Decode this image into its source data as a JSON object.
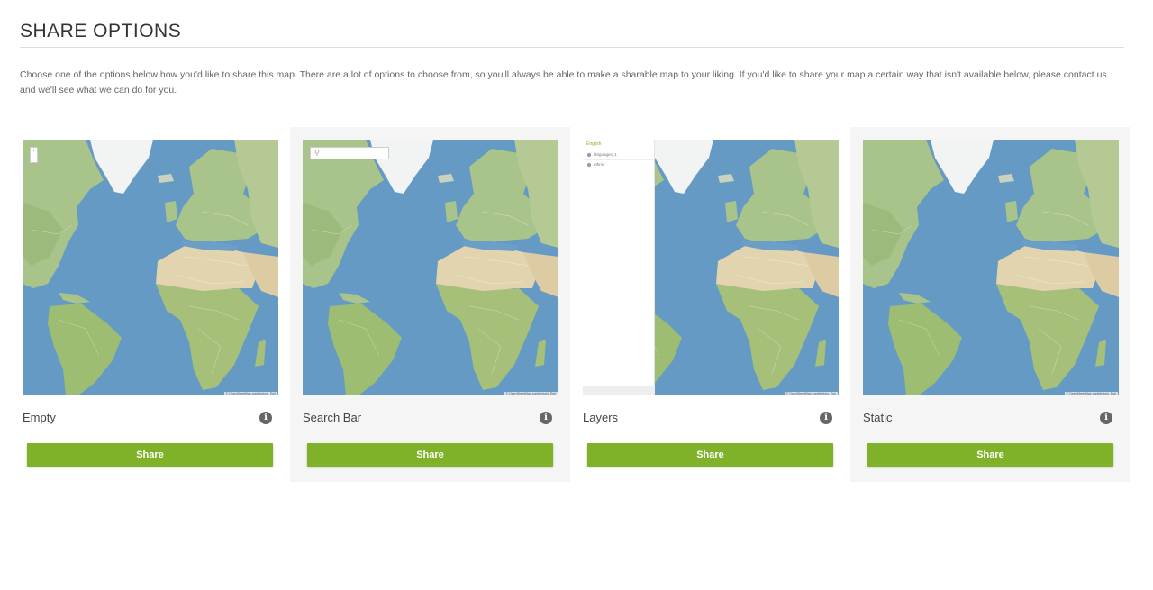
{
  "header": {
    "title": "SHARE OPTIONS",
    "intro": "Choose one of the options below how you'd like to share this map. There are a lot of options to choose from, so you'll always be able to make a sharable map to your liking. If you'd like to share your map a certain way that isn't available below, please contact us and we'll see what we can do for you."
  },
  "options": [
    {
      "label": "Empty",
      "button": "Share"
    },
    {
      "label": "Search Bar",
      "button": "Share"
    },
    {
      "label": "Layers",
      "button": "Share"
    },
    {
      "label": "Static",
      "button": "Share"
    }
  ],
  "layers_preview": {
    "title": "English",
    "rows": [
      "languages_1",
      "ethnic"
    ]
  },
  "map": {
    "zoom": "+",
    "attribution": "© OpenStreetMap contributors, Esri"
  },
  "colors": {
    "accent": "#7fb228",
    "ocean": "#6c9fc7",
    "land": "#a9c48a",
    "desert": "#e3d4b0",
    "ice": "#f2f4f4",
    "panel": "#f5f5f5"
  },
  "icons": [
    "info-icon",
    "search-icon",
    "visibility-icon"
  ]
}
